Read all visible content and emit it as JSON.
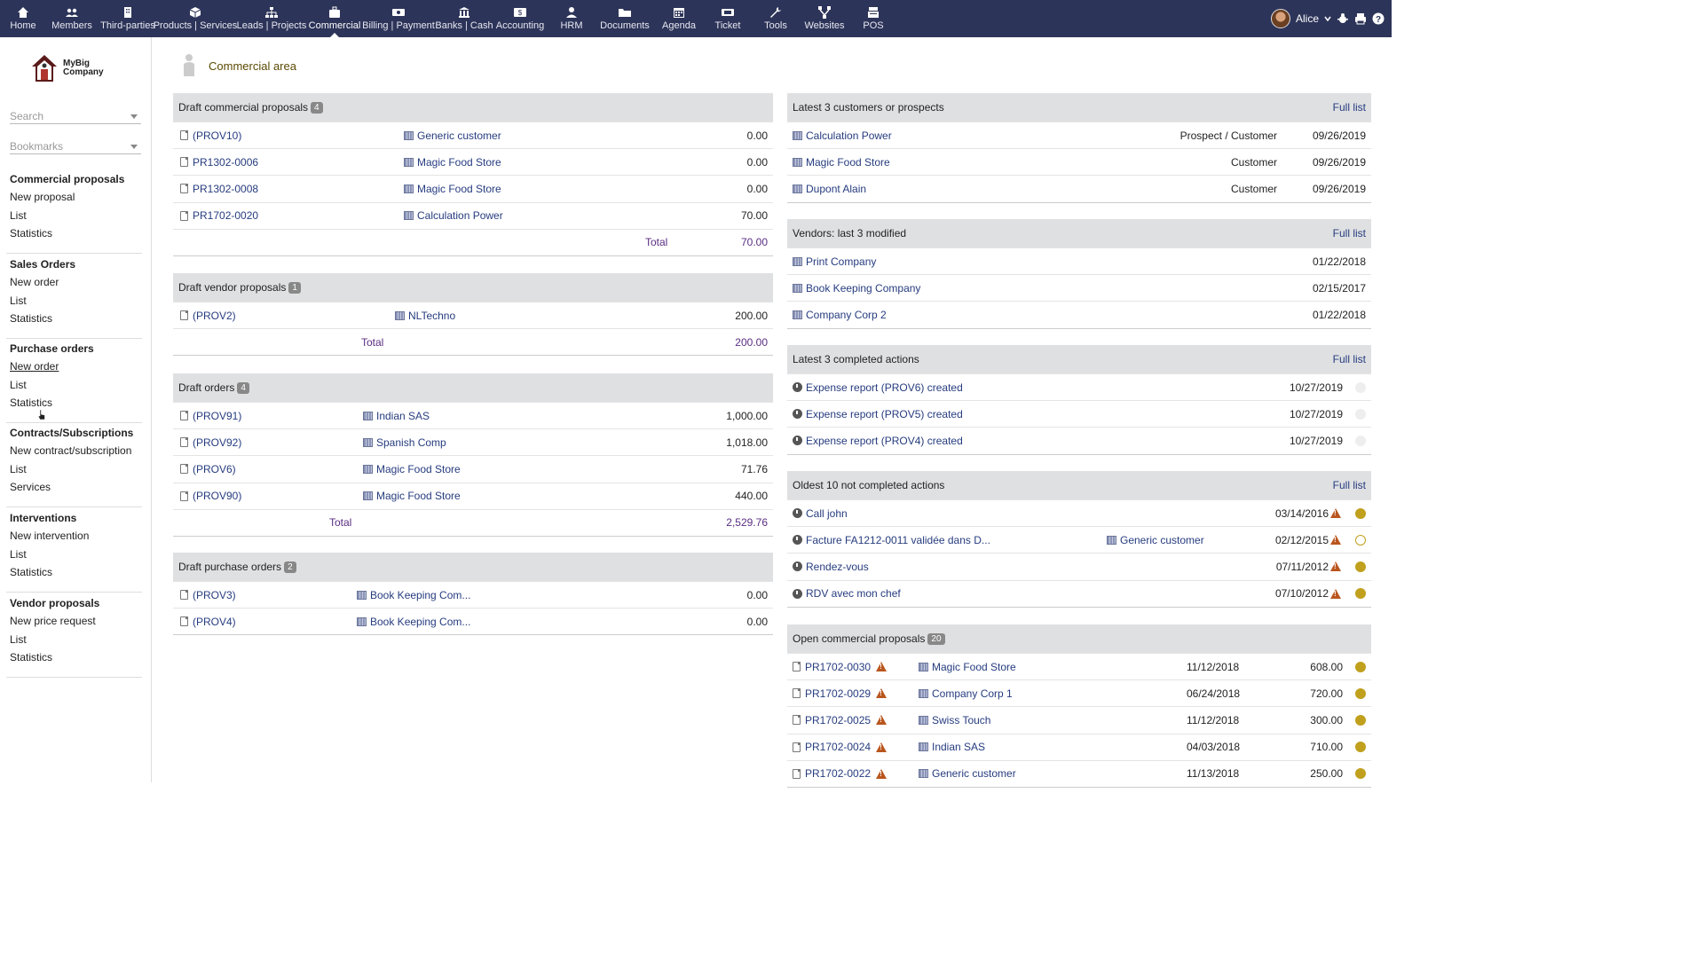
{
  "menu": [
    {
      "label": "Home",
      "icon": "home-icon"
    },
    {
      "label": "Members",
      "icon": "members-icon"
    },
    {
      "label": "Third-parties",
      "icon": "building-icon"
    },
    {
      "label": "Products | Services",
      "icon": "cube-icon"
    },
    {
      "label": "Leads | Projects",
      "icon": "sitemap-icon"
    },
    {
      "label": "Commercial",
      "icon": "suitcase-icon"
    },
    {
      "label": "Billing | Payment",
      "icon": "money-icon"
    },
    {
      "label": "Banks | Cash",
      "icon": "bank-icon"
    },
    {
      "label": "Accounting",
      "icon": "dollar-card-icon"
    },
    {
      "label": "HRM",
      "icon": "user-tie-icon"
    },
    {
      "label": "Documents",
      "icon": "folder-icon"
    },
    {
      "label": "Agenda",
      "icon": "calendar-icon"
    },
    {
      "label": "Ticket",
      "icon": "ticket-icon"
    },
    {
      "label": "Tools",
      "icon": "wrench-icon"
    },
    {
      "label": "Websites",
      "icon": "network-icon"
    },
    {
      "label": "POS",
      "icon": "cash-register-icon"
    }
  ],
  "user": {
    "name": "Alice"
  },
  "logo": {
    "line1": "MyBig",
    "line2": "Company"
  },
  "search": {
    "placeholder": "Search"
  },
  "bookmarks": {
    "placeholder": "Bookmarks"
  },
  "sidebar": [
    {
      "title": "Commercial proposals",
      "items": [
        "New proposal",
        "List",
        "Statistics"
      ]
    },
    {
      "title": "Sales Orders",
      "items": [
        "New order",
        "List",
        "Statistics"
      ]
    },
    {
      "title": "Purchase orders",
      "items": [
        "New order",
        "List",
        "Statistics"
      ]
    },
    {
      "title": "Contracts/Subscriptions",
      "items": [
        "New contract/subscription",
        "List",
        "Services"
      ]
    },
    {
      "title": "Interventions",
      "items": [
        "New intervention",
        "List",
        "Statistics"
      ]
    },
    {
      "title": "Vendor proposals",
      "items": [
        "New price request",
        "List",
        "Statistics"
      ]
    }
  ],
  "page_title": "Commercial area",
  "labels": {
    "total": "Total",
    "full_list": "Full list"
  },
  "draft_props": {
    "title": "Draft commercial proposals",
    "count": "4",
    "total": "70.00",
    "rows": [
      [
        "(PROV10)",
        "Generic customer",
        "0.00"
      ],
      [
        "PR1302-0006",
        "Magic Food Store",
        "0.00"
      ],
      [
        "PR1302-0008",
        "Magic Food Store",
        "0.00"
      ],
      [
        "PR1702-0020",
        "Calculation Power",
        "70.00"
      ]
    ]
  },
  "draft_vendor": {
    "title": "Draft vendor proposals",
    "count": "1",
    "total": "200.00",
    "rows": [
      [
        "(PROV2)",
        "NLTechno",
        "200.00"
      ]
    ]
  },
  "draft_orders": {
    "title": "Draft orders",
    "count": "4",
    "total": "2,529.76",
    "rows": [
      [
        "(PROV91)",
        "Indian SAS",
        "1,000.00"
      ],
      [
        "(PROV92)",
        "Spanish Comp",
        "1,018.00"
      ],
      [
        "(PROV6)",
        "Magic Food Store",
        "71.76"
      ],
      [
        "(PROV90)",
        "Magic Food Store",
        "440.00"
      ]
    ]
  },
  "draft_po": {
    "title": "Draft purchase orders",
    "count": "2",
    "rows": [
      [
        "(PROV3)",
        "Book Keeping Com...",
        "0.00"
      ],
      [
        "(PROV4)",
        "Book Keeping Com...",
        "0.00"
      ]
    ]
  },
  "latest_customers": {
    "title": "Latest 3 customers or prospects",
    "rows": [
      [
        "Calculation Power",
        "Prospect / Customer",
        "09/26/2019"
      ],
      [
        "Magic Food Store",
        "Customer",
        "09/26/2019"
      ],
      [
        "Dupont Alain",
        "Customer",
        "09/26/2019"
      ]
    ]
  },
  "vendors": {
    "title": "Vendors: last 3 modified",
    "rows": [
      [
        "Print Company",
        "01/22/2018"
      ],
      [
        "Book Keeping Company",
        "02/15/2017"
      ],
      [
        "Company Corp 2",
        "01/22/2018"
      ]
    ]
  },
  "completed": {
    "title": "Latest 3 completed actions",
    "rows": [
      [
        "Expense report (PROV6) created",
        "10/27/2019"
      ],
      [
        "Expense report (PROV5) created",
        "10/27/2019"
      ],
      [
        "Expense report (PROV4) created",
        "10/27/2019"
      ]
    ]
  },
  "notcompleted": {
    "title": "Oldest 10 not completed actions",
    "rows": [
      [
        "Call john",
        "",
        "03/14/2016",
        "filled"
      ],
      [
        "Facture FA1212-0011 validée dans D...",
        "Generic customer",
        "02/12/2015",
        "open"
      ],
      [
        "Rendez-vous",
        "",
        "07/11/2012",
        "filled"
      ],
      [
        "RDV avec mon chef",
        "",
        "07/10/2012",
        "filled"
      ]
    ]
  },
  "open_props": {
    "title": "Open commercial proposals",
    "count": "20",
    "rows": [
      [
        "PR1702-0030",
        "Magic Food Store",
        "11/12/2018",
        "608.00"
      ],
      [
        "PR1702-0029",
        "Company Corp 1",
        "06/24/2018",
        "720.00"
      ],
      [
        "PR1702-0025",
        "Swiss Touch",
        "11/12/2018",
        "300.00"
      ],
      [
        "PR1702-0024",
        "Indian SAS",
        "04/03/2018",
        "710.00"
      ],
      [
        "PR1702-0022",
        "Generic customer",
        "11/13/2018",
        "250.00"
      ]
    ]
  }
}
